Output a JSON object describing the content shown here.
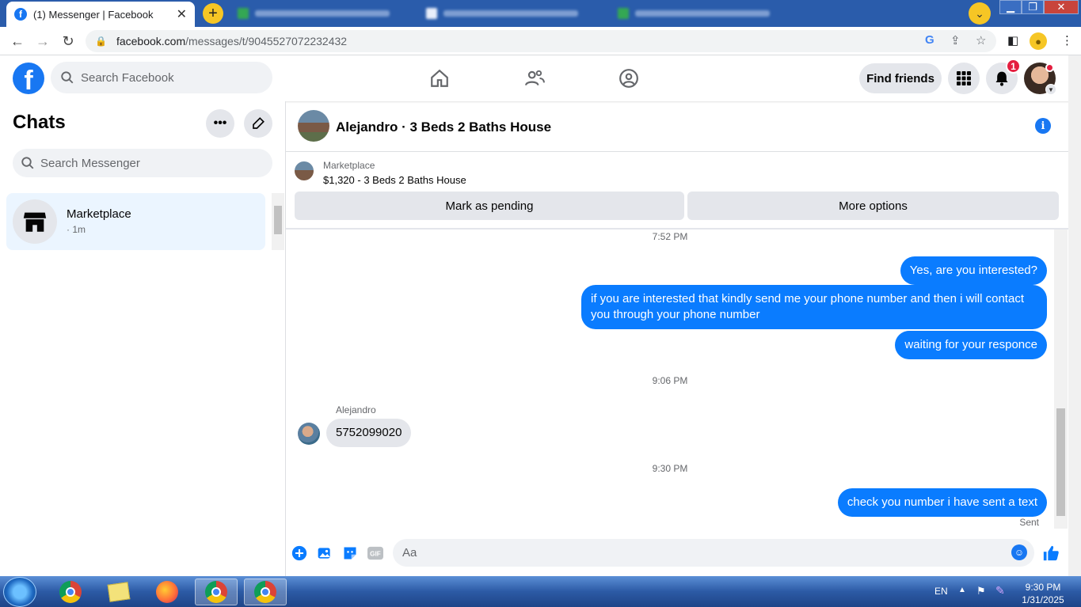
{
  "browser": {
    "active_tab_title": "(1) Messenger | Facebook",
    "url_host": "facebook.com",
    "url_path": "/messages/t/9045527072232432"
  },
  "header": {
    "search_placeholder": "Search Facebook",
    "find_friends_label": "Find friends",
    "notification_count": "1"
  },
  "sidebar": {
    "title": "Chats",
    "search_placeholder": "Search Messenger",
    "chats": [
      {
        "name": "Marketplace",
        "time": "· 1m"
      }
    ]
  },
  "conversation": {
    "title": "Alejandro · 3 Beds 2 Baths House",
    "marketplace_label": "Marketplace",
    "listing": "$1,320 - 3 Beds 2 Baths House",
    "mark_pending_label": "Mark as pending",
    "more_options_label": "More options",
    "messages": [
      {
        "type": "timestamp",
        "text": "7:52 PM"
      },
      {
        "type": "out",
        "text": "Yes, are you interested?"
      },
      {
        "type": "out",
        "text": "if you are interested that kindly send me your phone number and then i will contact you through your phone number"
      },
      {
        "type": "out",
        "text": "waiting for your responce"
      },
      {
        "type": "timestamp",
        "text": "9:06 PM"
      },
      {
        "type": "sender",
        "text": "Alejandro"
      },
      {
        "type": "in",
        "text": "5752099020"
      },
      {
        "type": "timestamp",
        "text": "9:30 PM"
      },
      {
        "type": "out",
        "text": "check you number i have sent a text"
      },
      {
        "type": "status",
        "text": "Sent"
      }
    ],
    "composer_placeholder": "Aa"
  },
  "taskbar": {
    "language": "EN",
    "time": "9:30 PM",
    "date": "1/31/2025"
  },
  "colors": {
    "accent": "#1877f2",
    "bubble_out": "#0a7cff",
    "bubble_in": "#e4e6eb"
  }
}
